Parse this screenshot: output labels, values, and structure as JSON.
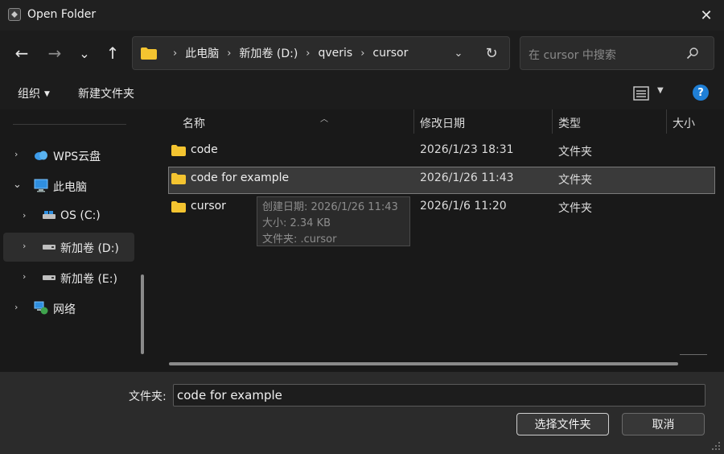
{
  "window": {
    "title": "Open Folder",
    "close_glyph": "✕"
  },
  "nav": {
    "back": "←",
    "forward": "→",
    "recent": "⌄",
    "up": "↑"
  },
  "address": {
    "crumbs": [
      "此电脑",
      "新加卷 (D:)",
      "qveris",
      "cursor"
    ],
    "dropdown": "⌄",
    "refresh": "↻"
  },
  "search": {
    "placeholder": "在 cursor 中搜索"
  },
  "command_bar": {
    "organize": "组织",
    "new_folder": "新建文件夹",
    "help": "?"
  },
  "sidebar": {
    "items": [
      {
        "label": "WPS云盘",
        "icon": "cloud-icon"
      },
      {
        "label": "此电脑",
        "icon": "computer-icon"
      },
      {
        "label": "OS (C:)",
        "icon": "drive-icon"
      },
      {
        "label": "新加卷 (D:)",
        "icon": "drive-icon"
      },
      {
        "label": "新加卷 (E:)",
        "icon": "drive-icon"
      },
      {
        "label": "网络",
        "icon": "network-icon"
      }
    ]
  },
  "columns": {
    "name": "名称",
    "modified": "修改日期",
    "type": "类型",
    "size": "大小"
  },
  "files": [
    {
      "name": "code",
      "modified": "2026/1/23 18:31",
      "type": "文件夹"
    },
    {
      "name": "code for example",
      "modified": "2026/1/26 11:43",
      "type": "文件夹"
    },
    {
      "name": "cursor",
      "modified": "2026/1/6 11:20",
      "type": "文件夹"
    }
  ],
  "tooltip": {
    "created": "创建日期: 2026/1/26 11:43",
    "size": "大小: 2.34 KB",
    "folder": "文件夹: .cursor"
  },
  "footer": {
    "folder_label": "文件夹:",
    "folder_value": "code for example",
    "select_button": "选择文件夹",
    "cancel_button": "取消"
  },
  "colors": {
    "folder": "#f4c430",
    "accent": "#1f7fd6",
    "cloud": "#3d9be9"
  }
}
